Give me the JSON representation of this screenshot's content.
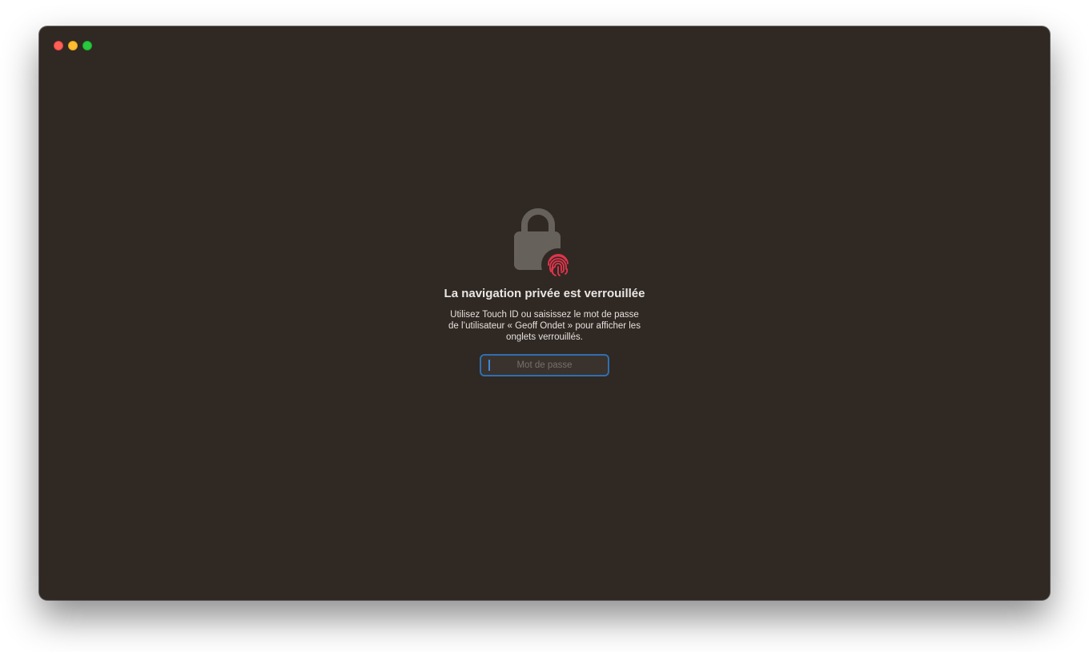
{
  "window": {
    "background": "#302823"
  },
  "traffic_lights": {
    "close_color": "#fe5f57",
    "minimize_color": "#febc2e",
    "maximize_color": "#28c840"
  },
  "lock_screen": {
    "icon": "lock-icon",
    "badge_icon": "touch-id-fingerprint-icon",
    "title": "La navigation privée est verrouillée",
    "description": "Utilisez Touch ID ou saisissez le mot de passe de l’utilisateur « Geoff Ondet » pour afficher les onglets verrouillés.",
    "password_field": {
      "placeholder": "Mot de passe",
      "value": ""
    }
  },
  "colors": {
    "accent_focus": "#2f6fb0",
    "fingerprint": "#e5344d"
  }
}
